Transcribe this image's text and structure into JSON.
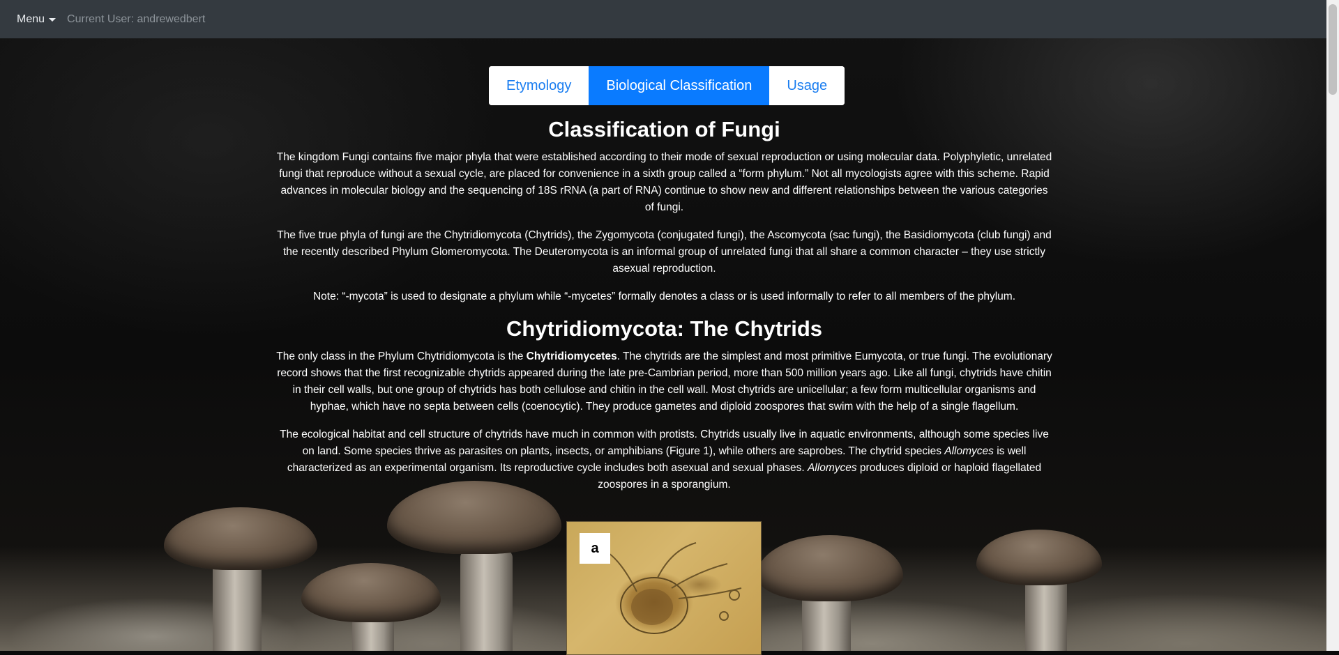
{
  "navbar": {
    "menu_label": "Menu",
    "current_user": "Current User: andrewedbert"
  },
  "tabs": [
    {
      "label": "Etymology",
      "active": false
    },
    {
      "label": "Biological Classification",
      "active": true
    },
    {
      "label": "Usage",
      "active": false
    }
  ],
  "content": {
    "title": "Classification of Fungi",
    "intro_paragraphs": [
      "The kingdom Fungi contains five major phyla that were established according to their mode of sexual reproduction or using molecular data. Polyphyletic, unrelated fungi that reproduce without a sexual cycle, are placed for convenience in a sixth group called a “form phylum.” Not all mycologists agree with this scheme. Rapid advances in molecular biology and the sequencing of 18S rRNA (a part of RNA) continue to show new and different relationships between the various categories of fungi.",
      "The five true phyla of fungi are the Chytridiomycota (Chytrids), the Zygomycota (conjugated fungi), the Ascomycota (sac fungi), the Basidiomycota (club fungi) and the recently described Phylum Glomeromycota. The Deuteromycota is an informal group of unrelated fungi that all share a common character – they use strictly asexual reproduction.",
      "Note: “-mycota” is used to designate a phylum while “-mycetes” formally denotes a class or is used informally to refer to all members of the phylum."
    ],
    "section_title": "Chytridiomycota: The Chytrids",
    "chytrid_p1": {
      "before": "The only class in the Phylum Chytridiomycota is the ",
      "bold": "Chytridiomycetes",
      "after": ". The chytrids are the simplest and most primitive Eumycota, or true fungi. The evolutionary record shows that the first recognizable chytrids appeared during the late pre-Cambrian period, more than 500 million years ago. Like all fungi, chytrids have chitin in their cell walls, but one group of chytrids has both cellulose and chitin in the cell wall. Most chytrids are unicellular; a few form multicellular organisms and hyphae, which have no septa between cells (coenocytic). They produce gametes and diploid zoospores that swim with the help of a single flagellum."
    },
    "chytrid_p2": {
      "part1": "The ecological habitat and cell structure of chytrids have much in common with protists. Chytrids usually live in aquatic environments, although some species live on land. Some species thrive as parasites on plants, insects, or amphibians (Figure 1), while others are saprobes. The chytrid species ",
      "italic1": "Allomyces",
      "part2": " is well characterized as an experimental organism. Its reproductive cycle includes both asexual and sexual phases. ",
      "italic2": "Allomyces",
      "part3": " produces diploid or haploid flagellated zoospores in a sporangium."
    },
    "figure_label": "a"
  },
  "colors": {
    "navbar_bg": "#343a40",
    "tab_active_bg": "#0a7bff",
    "tab_text": "#1a7df0"
  }
}
